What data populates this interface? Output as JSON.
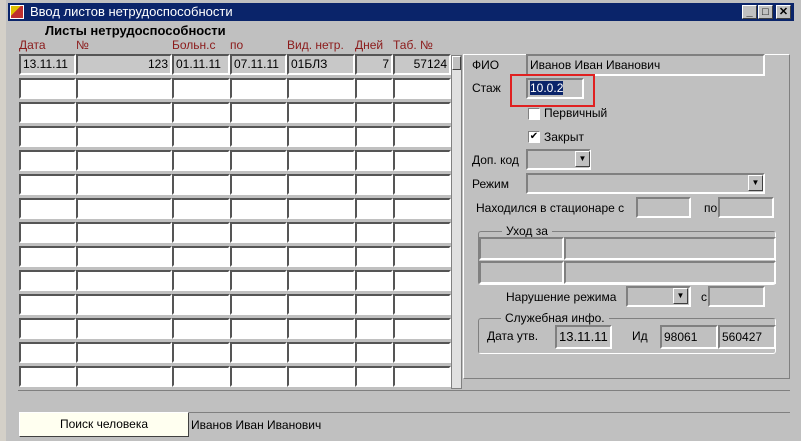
{
  "window": {
    "title": "Ввод листов нетрудоспособности",
    "min": "_",
    "max": "□",
    "close": "✕"
  },
  "section_title": "Листы нетрудоспособности",
  "columns": [
    "Дата",
    "№",
    "Больн.с",
    "по",
    "Вид. нетр.",
    "Дней",
    "Таб. №"
  ],
  "rows": [
    [
      "13.11.11",
      "123",
      "01.11.11",
      "07.11.11",
      "01БЛЗ",
      "7",
      "57124"
    ],
    [
      "",
      "",
      "",
      "",
      "",
      "",
      ""
    ],
    [
      "",
      "",
      "",
      "",
      "",
      "",
      ""
    ],
    [
      "",
      "",
      "",
      "",
      "",
      "",
      ""
    ],
    [
      "",
      "",
      "",
      "",
      "",
      "",
      ""
    ],
    [
      "",
      "",
      "",
      "",
      "",
      "",
      ""
    ],
    [
      "",
      "",
      "",
      "",
      "",
      "",
      ""
    ],
    [
      "",
      "",
      "",
      "",
      "",
      "",
      ""
    ],
    [
      "",
      "",
      "",
      "",
      "",
      "",
      ""
    ],
    [
      "",
      "",
      "",
      "",
      "",
      "",
      ""
    ],
    [
      "",
      "",
      "",
      "",
      "",
      "",
      ""
    ],
    [
      "",
      "",
      "",
      "",
      "",
      "",
      ""
    ],
    [
      "",
      "",
      "",
      "",
      "",
      "",
      ""
    ],
    [
      "",
      "",
      "",
      "",
      "",
      "",
      ""
    ]
  ],
  "form": {
    "fio_label": "ФИО",
    "fio": "Иванов Иван Иванович",
    "stazh_label": "Стаж",
    "stazh": "10.0.2",
    "primary_label": "Первичный",
    "primary_checked": false,
    "closed_label": "Закрыт",
    "closed_checked": true,
    "check_mark": "✔",
    "dop_kod_label": "Доп. код",
    "dop_kod": "",
    "rezhim_label": "Режим",
    "rezhim": "",
    "hospital_label": "Находился в стационаре с",
    "hospital_from": "",
    "hospital_to_label": "по",
    "hospital_to": "",
    "care_group": "Уход за",
    "violation_label": "Нарушение режима",
    "violation": "",
    "violation_from_label": "с",
    "violation_from": "",
    "service_group": "Служебная инфо.",
    "approve_date_label": "Дата утв.",
    "approve_date": "13.11.11",
    "id_label": "Ид",
    "id1": "98061",
    "id2": "560427"
  },
  "footer": {
    "search_button": "Поиск человека",
    "person": "Иванов Иван Иванович"
  }
}
